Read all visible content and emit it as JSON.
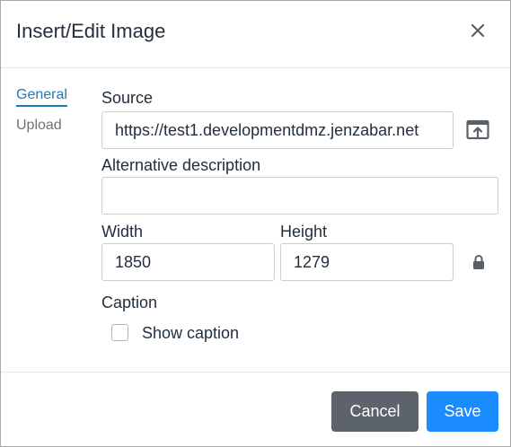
{
  "dialog": {
    "title": "Insert/Edit Image",
    "close_icon": "close-icon"
  },
  "tabs": [
    {
      "label": "General",
      "active": true
    },
    {
      "label": "Upload",
      "active": false
    }
  ],
  "form": {
    "source": {
      "label": "Source",
      "value": "https://test1.developmentdmz.jenzabar.net",
      "browse_icon": "upload-browse-icon"
    },
    "alt": {
      "label": "Alternative description",
      "value": ""
    },
    "width": {
      "label": "Width",
      "value": "1850"
    },
    "height": {
      "label": "Height",
      "value": "1279"
    },
    "lock_icon": "lock-icon",
    "caption": {
      "label": "Caption",
      "checkbox_label": "Show caption",
      "checked": false
    }
  },
  "footer": {
    "cancel_label": "Cancel",
    "save_label": "Save"
  },
  "colors": {
    "accent": "#207ab7",
    "save": "#1b8cff",
    "cancel": "#5d636b"
  }
}
